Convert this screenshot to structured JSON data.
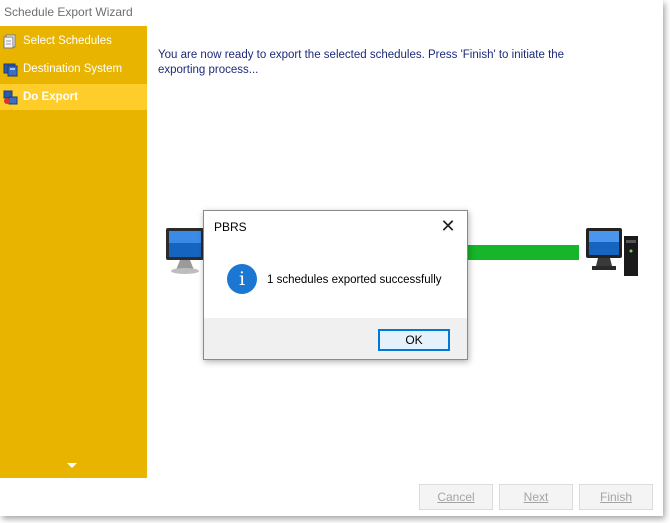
{
  "window": {
    "title": "Schedule Export Wizard"
  },
  "sidebar": {
    "items": [
      {
        "label": "Select Schedules",
        "icon": "document-icon"
      },
      {
        "label": "Destination System",
        "icon": "server-icon"
      },
      {
        "label": "Do Export",
        "icon": "export-icon",
        "active": true
      }
    ],
    "scroll_icon": "chevron-down-icon"
  },
  "main": {
    "message": "You are now ready to export the selected schedules. Press 'Finish' to initiate the exporting process..."
  },
  "progress": {
    "color": "#16b52a"
  },
  "footer": {
    "cancel_label": "Cancel",
    "next_label": "Next",
    "finish_label": "Finish"
  },
  "dialog": {
    "title": "PBRS",
    "message": "1 schedules exported successfully",
    "ok_label": "OK",
    "icon": "info-icon",
    "close_icon": "close-icon"
  },
  "colors": {
    "sidebar": "#e8b400",
    "sidebar_active": "#ffcd29",
    "text_blue": "#1d2a7a",
    "info_blue": "#1c77d2"
  }
}
